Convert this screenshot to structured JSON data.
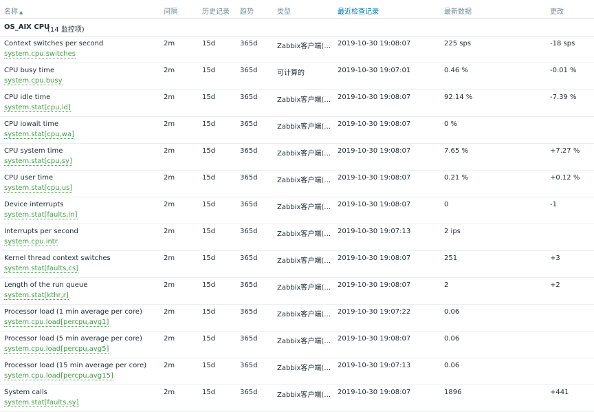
{
  "header": {
    "name": "名称",
    "interval": "间隔",
    "history": "历史记录",
    "trends": "趋势",
    "type": "类型",
    "last_check": "最近检查记录",
    "last_value": "最新数据",
    "change": "更改",
    "sort_arrow": "▲"
  },
  "group": {
    "name": "OS_AIX CPU",
    "count": "(14 监控项)"
  },
  "rows": [
    {
      "name": "Context switches per second",
      "key": "system.cpu.switches",
      "interval": "2m",
      "history": "15d",
      "trends": "365d",
      "type": "Zabbix客户端(…",
      "last_check": "2019-10-30 19:08:07",
      "last_value": "225 sps",
      "change": "-18 sps"
    },
    {
      "name": "CPU busy time",
      "key": "system.cpu.busy",
      "interval": "2m",
      "history": "15d",
      "trends": "365d",
      "type": "可计算的",
      "last_check": "2019-10-30 19:07:01",
      "last_value": "0.46 %",
      "change": "-0.01 %"
    },
    {
      "name": "CPU idle time",
      "key": "system.stat[cpu,id]",
      "interval": "2m",
      "history": "15d",
      "trends": "365d",
      "type": "Zabbix客户端(…",
      "last_check": "2019-10-30 19:08:07",
      "last_value": "92.14 %",
      "change": "-7.39 %"
    },
    {
      "name": "CPU iowait time",
      "key": "system.stat[cpu,wa]",
      "interval": "2m",
      "history": "15d",
      "trends": "365d",
      "type": "Zabbix客户端(…",
      "last_check": "2019-10-30 19:08:07",
      "last_value": "0 %",
      "change": ""
    },
    {
      "name": "CPU system time",
      "key": "system.stat[cpu,sy]",
      "interval": "2m",
      "history": "15d",
      "trends": "365d",
      "type": "Zabbix客户端(…",
      "last_check": "2019-10-30 19:08:07",
      "last_value": "7.65 %",
      "change": "+7.27 %"
    },
    {
      "name": "CPU user time",
      "key": "system.stat[cpu,us]",
      "interval": "2m",
      "history": "15d",
      "trends": "365d",
      "type": "Zabbix客户端(…",
      "last_check": "2019-10-30 19:08:07",
      "last_value": "0.21 %",
      "change": "+0.12 %"
    },
    {
      "name": "Device interrupts",
      "key": "system.stat[faults,in]",
      "interval": "2m",
      "history": "15d",
      "trends": "365d",
      "type": "Zabbix客户端(…",
      "last_check": "2019-10-30 19:08:07",
      "last_value": "0",
      "change": "-1"
    },
    {
      "name": "Interrupts per second",
      "key": "system.cpu.intr",
      "interval": "2m",
      "history": "15d",
      "trends": "365d",
      "type": "Zabbix客户端(…",
      "last_check": "2019-10-30 19:07:13",
      "last_value": "2 ips",
      "change": ""
    },
    {
      "name": "Kernel thread context switches",
      "key": "system.stat[faults,cs]",
      "interval": "2m",
      "history": "15d",
      "trends": "365d",
      "type": "Zabbix客户端(…",
      "last_check": "2019-10-30 19:08:07",
      "last_value": "251",
      "change": "+3"
    },
    {
      "name": "Length of the run queue",
      "key": "system.stat[kthr,r]",
      "interval": "2m",
      "history": "15d",
      "trends": "365d",
      "type": "Zabbix客户端(…",
      "last_check": "2019-10-30 19:08:07",
      "last_value": "2",
      "change": "+2"
    },
    {
      "name": "Processor load (1 min average per core)",
      "key": "system.cpu.load[percpu,avg1]",
      "interval": "2m",
      "history": "15d",
      "trends": "365d",
      "type": "Zabbix客户端(…",
      "last_check": "2019-10-30 19:07:22",
      "last_value": "0.06",
      "change": ""
    },
    {
      "name": "Processor load (5 min average per core)",
      "key": "system.cpu.load[percpu,avg5]",
      "interval": "2m",
      "history": "15d",
      "trends": "365d",
      "type": "Zabbix客户端(…",
      "last_check": "2019-10-30 19:08:07",
      "last_value": "0.06",
      "change": ""
    },
    {
      "name": "Processor load (15 min average per core)",
      "key": "system.cpu.load[percpu,avg15]",
      "interval": "2m",
      "history": "15d",
      "trends": "365d",
      "type": "Zabbix客户端(…",
      "last_check": "2019-10-30 19:07:13",
      "last_value": "0.06",
      "change": ""
    },
    {
      "name": "System calls",
      "key": "system.stat[faults,sy]",
      "interval": "2m",
      "history": "15d",
      "trends": "365d",
      "type": "Zabbix客户端(…",
      "last_check": "2019-10-30 19:08:07",
      "last_value": "1896",
      "change": "+441"
    }
  ]
}
